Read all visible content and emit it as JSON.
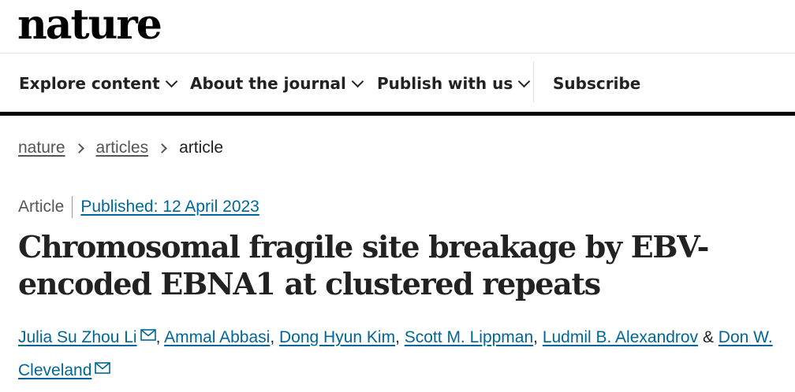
{
  "header": {
    "logo_text": "nature"
  },
  "nav": {
    "items": [
      {
        "label": "Explore content",
        "icon": "chevron-down-icon"
      },
      {
        "label": "About the journal",
        "icon": "chevron-down-icon"
      },
      {
        "label": "Publish with us",
        "icon": "chevron-down-icon"
      }
    ],
    "subscribe_label": "Subscribe"
  },
  "breadcrumb": {
    "items": [
      "nature",
      "articles"
    ],
    "current": "article",
    "separator_icon": "chevron-right-icon"
  },
  "article": {
    "type": "Article",
    "published": "Published: 12 April 2023",
    "title": "Chromosomal fragile site breakage by EBV-encoded EBNA1 at clustered repeats",
    "authors": [
      {
        "name": "Julia Su Zhou Li",
        "after": "",
        "mail_icon": true
      },
      {
        "name": "Ammal Abbasi",
        "after": ", ",
        "mail_icon": false
      },
      {
        "name": "Dong Hyun Kim",
        "after": ", ",
        "mail_icon": false
      },
      {
        "name": "Scott M. Lippman",
        "after": ", ",
        "mail_icon": false
      },
      {
        "name": "Ludmil B. Alexandrov",
        "after": " & ",
        "mail_icon": false
      },
      {
        "name": "Don W. Cleveland",
        "after": "",
        "mail_icon": true
      }
    ],
    "author_separators": [
      ", ",
      ", ",
      ", ",
      ", ",
      " & "
    ],
    "mail_icon_name": "mail-icon"
  },
  "colors": {
    "link": "#006699",
    "text": "#222222",
    "muted": "#555555",
    "bar": "#000000"
  }
}
